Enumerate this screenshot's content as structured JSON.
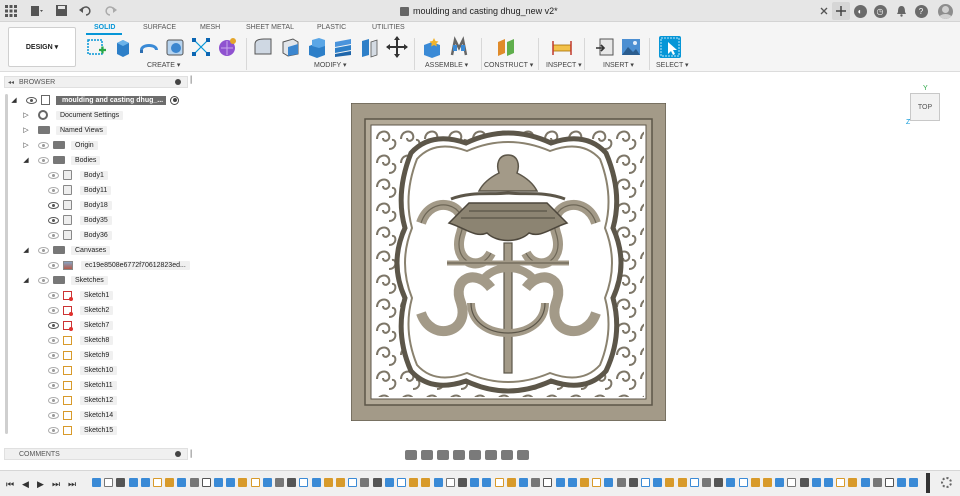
{
  "window": {
    "title": "moulding and casting  dhug_new v2*"
  },
  "toolbar": {
    "workspace_label": "DESIGN ▾",
    "tabs": [
      "SOLID",
      "SURFACE",
      "MESH",
      "SHEET METAL",
      "PLASTIC",
      "UTILITIES"
    ],
    "active_tab": "SOLID",
    "groups": [
      "CREATE ▾",
      "MODIFY ▾",
      "ASSEMBLE ▾",
      "CONSTRUCT ▾",
      "INSPECT ▾",
      "INSERT ▾",
      "SELECT ▾"
    ]
  },
  "browser": {
    "header": "BROWSER",
    "root_label": "moulding and casting  dhug_...",
    "items": {
      "document_settings": "Document Settings",
      "named_views": "Named Views",
      "origin": "Origin",
      "bodies": "Bodies",
      "canvases": "Canvases",
      "canvas_item": "ec19e8508e6772f70612823ed...",
      "sketches": "Sketches"
    },
    "bodies": [
      "Body1",
      "Body11",
      "Body18",
      "Body35",
      "Body36"
    ],
    "sketches": [
      "Sketch1",
      "Sketch2",
      "Sketch7",
      "Sketch8",
      "Sketch9",
      "Sketch10",
      "Sketch11",
      "Sketch12",
      "Sketch14",
      "Sketch15"
    ]
  },
  "comments": {
    "label": "COMMENTS"
  },
  "viewcube": {
    "face": "TOP",
    "axis_y": "Y",
    "axis_z": "Z"
  },
  "colors": {
    "accent": "#0696d7",
    "model_fill": "#a39a88",
    "model_dark": "#6e6757"
  }
}
